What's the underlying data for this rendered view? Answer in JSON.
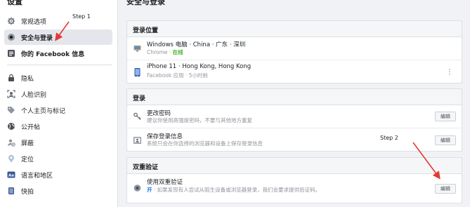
{
  "sidebar": {
    "title": "设置",
    "items": [
      {
        "label": "常规选项",
        "icon": "gear-icon"
      },
      {
        "label": "安全与登录",
        "icon": "shield-icon"
      },
      {
        "label": "你的 Facebook 信息",
        "icon": "facebook-info-icon"
      },
      {
        "label": "隐私",
        "icon": "lock-icon"
      },
      {
        "label": "人脸识别",
        "icon": "face-recognition-icon"
      },
      {
        "label": "个人主页与标记",
        "icon": "tag-icon"
      },
      {
        "label": "公开帖",
        "icon": "globe-icon"
      },
      {
        "label": "屏蔽",
        "icon": "block-user-icon"
      },
      {
        "label": "定位",
        "icon": "location-pin-icon"
      },
      {
        "label": "语言和地区",
        "icon": "language-icon"
      },
      {
        "label": "快拍",
        "icon": "story-icon"
      }
    ]
  },
  "main": {
    "title": "安全与登录",
    "login_locations": {
      "header": "登录位置",
      "rows": [
        {
          "device": "Windows 电脑 · China · 广东 · 深圳",
          "app": "Chrome · ",
          "status": "在线"
        },
        {
          "device": "iPhone 11 · Hong Kong, Hong Kong",
          "app": "Facebook 应用 · 5小时前"
        }
      ]
    },
    "login": {
      "header": "登录",
      "rows": [
        {
          "title": "更改密码",
          "desc": "建议你使用高强度密码，不要与其他地方重复",
          "button": "编辑"
        },
        {
          "title": "保存登录信息",
          "desc": "系统只会在你选择的浏览器和设备上保存登录信息",
          "button": "编辑"
        }
      ]
    },
    "two_factor": {
      "header": "双重验证",
      "rows": [
        {
          "title": "使用双重验证",
          "status": "开",
          "desc": " · 如果发现有人尝试从陌生设备或浏览器登录，我们会要求提供验证码。",
          "button": "编辑"
        }
      ]
    }
  },
  "annotations": {
    "step1": "Step 1",
    "step2": "Step 2",
    "arrow_color": "#e53935"
  }
}
